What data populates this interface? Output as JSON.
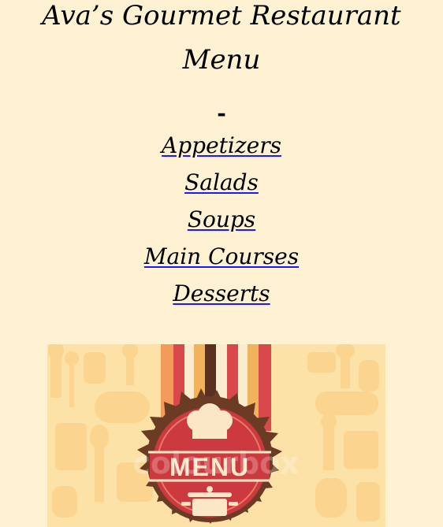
{
  "header": {
    "title": "Ava’s Gourmet Restaurant",
    "subtitle": "Menu",
    "separator": "-"
  },
  "nav": {
    "items": [
      {
        "label": "Appetizers"
      },
      {
        "label": "Salads"
      },
      {
        "label": "Soups"
      },
      {
        "label": "Main Courses"
      },
      {
        "label": "Desserts"
      }
    ]
  },
  "banner": {
    "sign_text": "MENU",
    "watermark": "colourbox",
    "colors": {
      "background": "#fde2a7",
      "silhouette": "#fbd48f",
      "badge_outer": "#6b3b23",
      "badge_inner": "#cc3a3f",
      "ribbon_red": "#d9484a",
      "ribbon_dark": "#5a3120",
      "ribbon_orange": "#f29b5a",
      "ribbon_cream": "#fbeccf",
      "chef_hat": "#fbe6c6"
    },
    "icons": [
      "chef-hat-icon",
      "cooking-pot-icon"
    ]
  }
}
